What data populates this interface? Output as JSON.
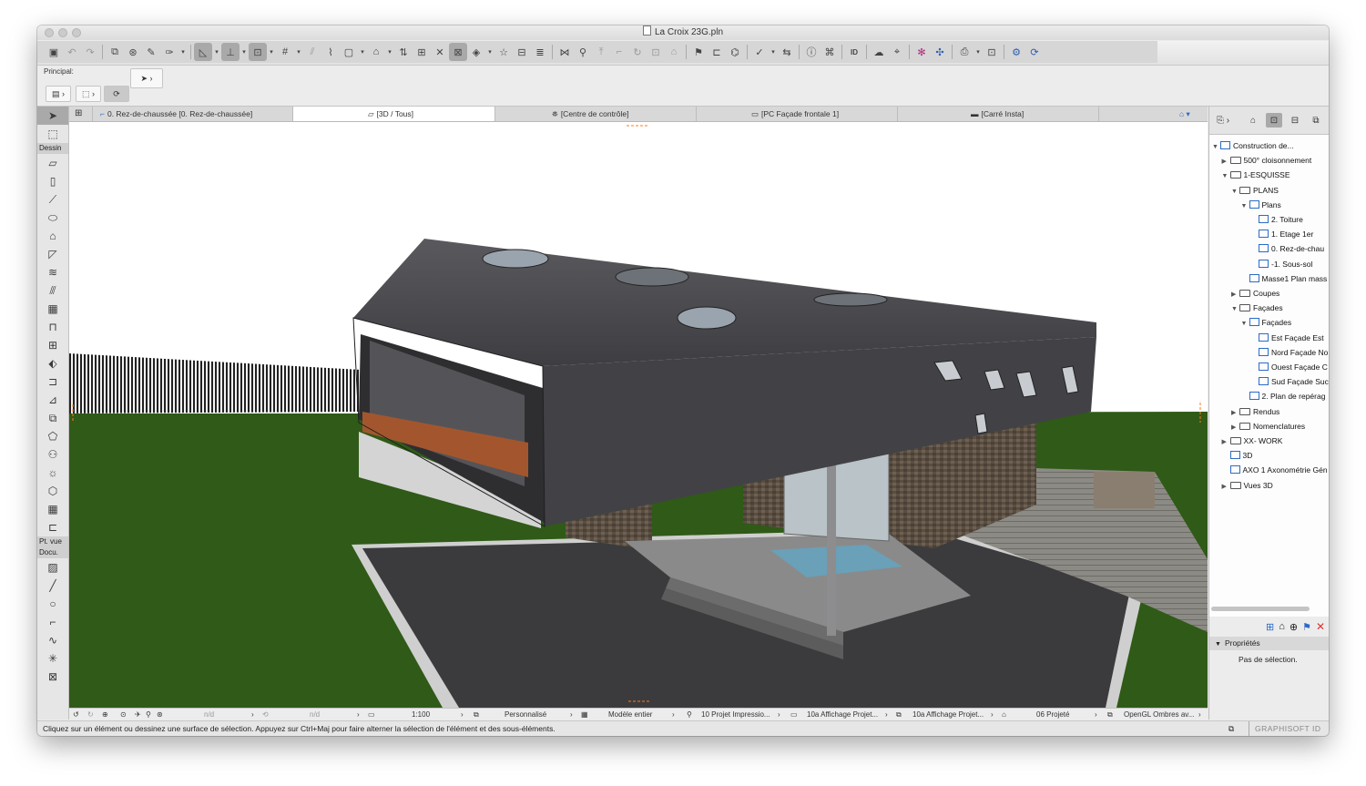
{
  "window": {
    "title": "La Croix 23G.pln"
  },
  "toolbar": {
    "icons": [
      "save-icon",
      "undo-icon",
      "redo-icon",
      "layers-icon",
      "find-select-icon",
      "eyedropper-icon",
      "syringe-icon",
      "suspend-groups-icon",
      "gravity-icon",
      "snap-icon",
      "grid-icon",
      "guides-icon",
      "magic-wand-icon",
      "lock-icon",
      "elevation-icon",
      "tracker-icon",
      "fit-icon",
      "marquee-icon",
      "view-3d-icon",
      "favorites-icon",
      "layout-icon",
      "publisher-icon",
      "trace-icon",
      "offset-icon",
      "move-icon",
      "stretch-icon",
      "rotate-icon",
      "mirror-icon",
      "area-icon",
      "flag-icon",
      "hotlink-icon",
      "renovation-icon",
      "teamwork-icon",
      "bim-icon",
      "info-icon",
      "id-icon",
      "cloud-icon",
      "tag-icon",
      "zones-icon",
      "graphic-overrides-icon",
      "layout-book-icon",
      "publish-icon",
      "bimx-icon",
      "print-icon"
    ]
  },
  "infobox": {
    "label": "Principal:"
  },
  "toolbox": {
    "sections": {
      "design": "Dessin",
      "viewpoint": "Pt. vue",
      "document": "Docu."
    }
  },
  "tabs": [
    {
      "label": "0. Rez-de-chaussée [0. Rez-de-chaussée]",
      "icon": "floor-plan-icon"
    },
    {
      "label": "[3D / Tous]",
      "icon": "cube-icon",
      "active": true
    },
    {
      "label": "[Centre de contrôle]",
      "icon": "control-tower-icon"
    },
    {
      "label": "[PC Façade frontale 1]",
      "icon": "facade-icon"
    },
    {
      "label": "[Carré Insta]",
      "icon": "image-icon"
    }
  ],
  "navigator": {
    "tree": [
      {
        "label": "Construction de...",
        "level": 0,
        "type": "root",
        "toggle": "open"
      },
      {
        "label": "500° cloisonnement",
        "level": 1,
        "type": "folder",
        "toggle": "closed"
      },
      {
        "label": "1-ESQUISSE",
        "level": 1,
        "type": "folder",
        "toggle": "open"
      },
      {
        "label": "PLANS",
        "level": 2,
        "type": "folder",
        "toggle": "open"
      },
      {
        "label": "Plans",
        "level": 3,
        "type": "view",
        "toggle": "open"
      },
      {
        "label": "2. Toiture",
        "level": 4,
        "type": "view",
        "toggle": ""
      },
      {
        "label": "1. Etage 1er",
        "level": 4,
        "type": "view",
        "toggle": ""
      },
      {
        "label": "0. Rez-de-chau",
        "level": 4,
        "type": "view",
        "toggle": ""
      },
      {
        "label": "-1. Sous-sol",
        "level": 4,
        "type": "view",
        "toggle": ""
      },
      {
        "label": "Masse1 Plan mass",
        "level": 3,
        "type": "view",
        "toggle": ""
      },
      {
        "label": "Coupes",
        "level": 2,
        "type": "folder",
        "toggle": "closed"
      },
      {
        "label": "Façades",
        "level": 2,
        "type": "folder",
        "toggle": "open"
      },
      {
        "label": "Façades",
        "level": 3,
        "type": "view",
        "toggle": "open"
      },
      {
        "label": "Est Façade Est",
        "level": 4,
        "type": "view",
        "toggle": ""
      },
      {
        "label": "Nord Façade No",
        "level": 4,
        "type": "view",
        "toggle": ""
      },
      {
        "label": "Ouest Façade C",
        "level": 4,
        "type": "view",
        "toggle": ""
      },
      {
        "label": "Sud Façade Suc",
        "level": 4,
        "type": "view",
        "toggle": ""
      },
      {
        "label": "2. Plan de repérag",
        "level": 3,
        "type": "view",
        "toggle": ""
      },
      {
        "label": "Rendus",
        "level": 2,
        "type": "folder",
        "toggle": "closed"
      },
      {
        "label": "Nomenclatures",
        "level": 2,
        "type": "folder",
        "toggle": "closed"
      },
      {
        "label": "XX- WORK",
        "level": 1,
        "type": "folder",
        "toggle": "closed"
      },
      {
        "label": "3D",
        "level": 1,
        "type": "view",
        "toggle": ""
      },
      {
        "label": "AXO 1 Axonométrie Gén",
        "level": 1,
        "type": "view",
        "toggle": ""
      },
      {
        "label": "Vues 3D",
        "level": 1,
        "type": "folder",
        "toggle": "closed"
      }
    ]
  },
  "properties": {
    "header": "Propriétés",
    "empty": "Pas de sélection."
  },
  "quick_options": {
    "nd1": "n/d",
    "nd2": "n/d",
    "scale": "1:100",
    "pen_set": "Personnalisé",
    "model_view": "Modèle entier",
    "graphic_override": "10 Projet Impressio...",
    "renovation_1": "10a Affichage Projet...",
    "renovation_2": "10a Affichage Projet...",
    "structure": "06 Projeté",
    "engine": "OpenGL Ombres av..."
  },
  "status": {
    "message": "Cliquez sur un élément ou dessinez une surface de sélection. Appuyez sur Ctrl+Maj pour faire alterner la sélection de l'élément et des sous-éléments.",
    "brand": "GRAPHISOFT ID"
  },
  "colors": {
    "grass": "#2f5a17",
    "roof": "#4a4a4d",
    "accent": "#ff7a1a",
    "sky": "#ffffff"
  }
}
